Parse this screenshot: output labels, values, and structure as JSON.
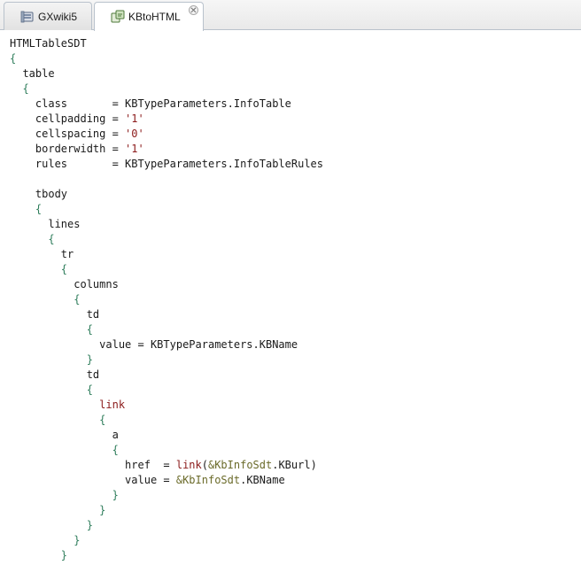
{
  "tabs": [
    {
      "label": "GXwiki5",
      "icon": "kb-icon",
      "active": false
    },
    {
      "label": "KBtoHTML",
      "icon": "transform-icon",
      "active": true,
      "close": "✕"
    }
  ],
  "code_lines": [
    [
      {
        "t": "HTMLTableSDT",
        "c": ""
      }
    ],
    [
      {
        "t": "{",
        "c": "brace"
      }
    ],
    [
      {
        "t": "  table",
        "c": ""
      }
    ],
    [
      {
        "t": "  ",
        "c": ""
      },
      {
        "t": "{",
        "c": "brace"
      }
    ],
    [
      {
        "t": "    class       = KBTypeParameters.InfoTable",
        "c": ""
      }
    ],
    [
      {
        "t": "    cellpadding = ",
        "c": ""
      },
      {
        "t": "'1'",
        "c": "str"
      }
    ],
    [
      {
        "t": "    cellspacing = ",
        "c": ""
      },
      {
        "t": "'0'",
        "c": "str"
      }
    ],
    [
      {
        "t": "    borderwidth = ",
        "c": ""
      },
      {
        "t": "'1'",
        "c": "str"
      }
    ],
    [
      {
        "t": "    rules       = KBTypeParameters.InfoTableRules",
        "c": ""
      }
    ],
    [
      {
        "t": "",
        "c": ""
      }
    ],
    [
      {
        "t": "    tbody",
        "c": ""
      }
    ],
    [
      {
        "t": "    ",
        "c": ""
      },
      {
        "t": "{",
        "c": "brace"
      }
    ],
    [
      {
        "t": "      lines",
        "c": ""
      }
    ],
    [
      {
        "t": "      ",
        "c": ""
      },
      {
        "t": "{",
        "c": "brace"
      }
    ],
    [
      {
        "t": "        tr",
        "c": ""
      }
    ],
    [
      {
        "t": "        ",
        "c": ""
      },
      {
        "t": "{",
        "c": "brace"
      }
    ],
    [
      {
        "t": "          columns",
        "c": ""
      }
    ],
    [
      {
        "t": "          ",
        "c": ""
      },
      {
        "t": "{",
        "c": "brace"
      }
    ],
    [
      {
        "t": "            td",
        "c": ""
      }
    ],
    [
      {
        "t": "            ",
        "c": ""
      },
      {
        "t": "{",
        "c": "brace"
      }
    ],
    [
      {
        "t": "              value = KBTypeParameters.KBName",
        "c": ""
      }
    ],
    [
      {
        "t": "            ",
        "c": ""
      },
      {
        "t": "}",
        "c": "brace"
      }
    ],
    [
      {
        "t": "            td",
        "c": ""
      }
    ],
    [
      {
        "t": "            ",
        "c": ""
      },
      {
        "t": "{",
        "c": "brace"
      }
    ],
    [
      {
        "t": "              ",
        "c": ""
      },
      {
        "t": "link",
        "c": "kw"
      }
    ],
    [
      {
        "t": "              ",
        "c": ""
      },
      {
        "t": "{",
        "c": "brace"
      }
    ],
    [
      {
        "t": "                a",
        "c": ""
      }
    ],
    [
      {
        "t": "                ",
        "c": ""
      },
      {
        "t": "{",
        "c": "brace"
      }
    ],
    [
      {
        "t": "                  href  = ",
        "c": ""
      },
      {
        "t": "link",
        "c": "kw"
      },
      {
        "t": "(",
        "c": ""
      },
      {
        "t": "&KbInfoSdt",
        "c": "var"
      },
      {
        "t": ".KBurl)",
        "c": ""
      }
    ],
    [
      {
        "t": "                  value = ",
        "c": ""
      },
      {
        "t": "&KbInfoSdt",
        "c": "var"
      },
      {
        "t": ".KBName",
        "c": ""
      }
    ],
    [
      {
        "t": "                ",
        "c": ""
      },
      {
        "t": "}",
        "c": "brace"
      }
    ],
    [
      {
        "t": "              ",
        "c": ""
      },
      {
        "t": "}",
        "c": "brace"
      }
    ],
    [
      {
        "t": "            ",
        "c": ""
      },
      {
        "t": "}",
        "c": "brace"
      }
    ],
    [
      {
        "t": "          ",
        "c": ""
      },
      {
        "t": "}",
        "c": "brace"
      }
    ],
    [
      {
        "t": "        ",
        "c": ""
      },
      {
        "t": "}",
        "c": "brace"
      }
    ]
  ],
  "colors": {
    "keyword": "#8b1a1a",
    "variable": "#6b6b2a",
    "brace": "#2e7d5b",
    "text": "#1a1a1a"
  }
}
